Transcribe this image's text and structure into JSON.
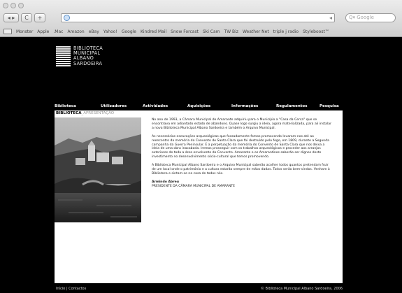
{
  "browser": {
    "back_label": "◂ ▸",
    "tool1_label": "C",
    "tool2_label": "+",
    "search_placeholder": "Google",
    "bookmarks": [
      "Monster",
      "Apple",
      ".Mac",
      "Amazon",
      "eBay",
      "Yahoo!",
      "Google",
      "Kindred Mail",
      "Snow Forcast",
      "Ski Cam",
      "TW Biz",
      "Weather Net",
      "triple j radio",
      "Styleboost™"
    ]
  },
  "site": {
    "logo_lines": [
      "BIBLIOTECA",
      "MUNICIPAL",
      "ALBANO",
      "SARDOEIRA"
    ],
    "menu": [
      "Biblioteca",
      "Utilizadores",
      "Actividades",
      "Aquisições",
      "Informações",
      "Regulamentos",
      "Pesquisa"
    ],
    "breadcrumb_section": "BIBLIOTECA",
    "breadcrumb_page": "_APRESENTAÇÃO",
    "paragraphs": [
      "No ano de 1993, a Câmara Municipal de Amarante adquiriu para o Município a \"Casa da Cerca\" que se encontrava em adiantado estado de abandono. Quase logo surgiu a ideia, agora materializada, para ali instalar a nova Biblioteca Municipal Albano Sardoeira e também o Arquivo Municipal.",
      "As necessárias escavações arqueológicas que fossadamente fomos promovendo levaram-nos até ao reencontro da memória do Convento de Santa Clara que foi destruído pelo fogo, em 1809, durante a Segunda campanha da Guerra Peninsular. É a perpetuação da memória do Convento de Santa Clara que nos deixa a ideia de uma obra inacabada. Iremos prosseguir com os trabalhos arqueológicos e proceder aos arranjos exteriores de toda a área envolvente do Convento. Amarante e os Amarantinos saberão ser dignos deste investimento no desenvolvimento sócio-cultural que temos promovendo.",
      "A Biblioteca Municipal Albano Sardoeira e o Arquivo Municipal saberão acolher todos quantos pretendam fruir de um local onde o património e a cultura estarão sempre de mãos dadas. Todos serão bem-vindos. Venham à Biblioteca e sintam-se na casa de todos nós."
    ],
    "signature_name": "Armindo Abreu",
    "signature_title": "PRESIDENTE DA CÂMARA MUNICIPAL DE AMARANTE",
    "footer_left": "Início | Contactos",
    "footer_right": "© Biblioteca Municipal Albano Sardoeira, 2006"
  }
}
